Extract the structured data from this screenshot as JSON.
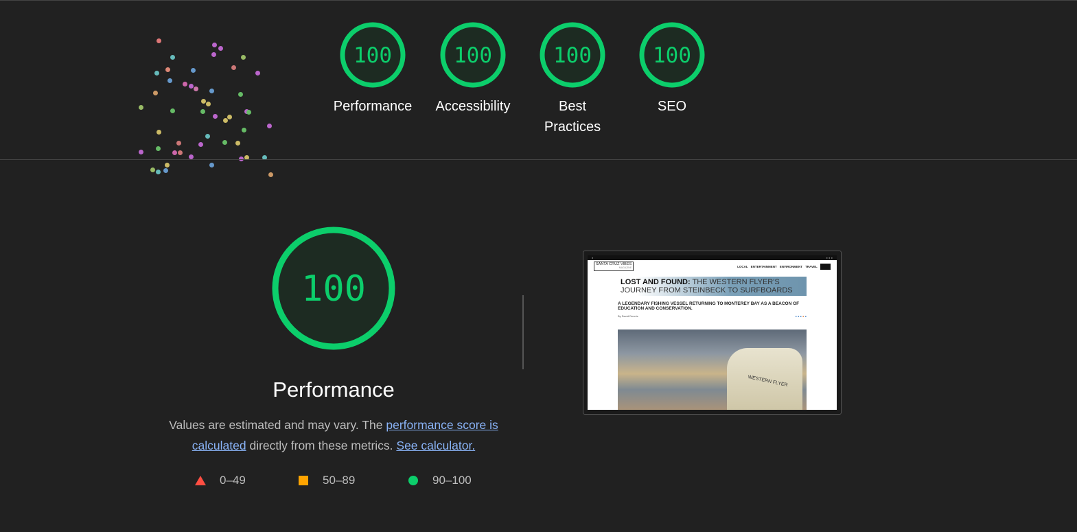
{
  "categories": [
    {
      "label": "Performance",
      "score": "100"
    },
    {
      "label": "Accessibility",
      "score": "100"
    },
    {
      "label": "Best Practices",
      "score": "100"
    },
    {
      "label": "SEO",
      "score": "100"
    }
  ],
  "main": {
    "score": "100",
    "title": "Performance",
    "desc_1": "Values are estimated and may vary. The ",
    "link_score": "performance score is calculated",
    "desc_2": " directly from these metrics. ",
    "link_calc": "See calculator."
  },
  "legend": [
    {
      "range": "0–49",
      "color": "#ff4e42",
      "shape": "triangle"
    },
    {
      "range": "50–89",
      "color": "#ffa400",
      "shape": "square"
    },
    {
      "range": "90–100",
      "color": "#0cce6b",
      "shape": "circle"
    }
  ],
  "colors": {
    "pass": "#0cce6b",
    "gauge_fill": "#1d2b22",
    "background": "#212121"
  },
  "screenshot": {
    "logo": "SANTA CRUZ VIBES",
    "logo_sub": "MAGAZINE",
    "nav": [
      "LOCAL",
      "ENTERTAINMENT",
      "ENVIRONMENT",
      "TRAVEL"
    ],
    "headline_bold": "LOST AND FOUND:",
    "headline_rest": " THE WESTERN FLYER'S JOURNEY FROM STEINBECK TO SURFBOARDS",
    "subhead": "A LEGENDARY FISHING VESSEL RETURNING TO MONTEREY BAY AS A BEACON OF EDUCATION AND CONSERVATION.",
    "byline": "By David Dennis",
    "boat_name": "WESTERN FLYER"
  }
}
